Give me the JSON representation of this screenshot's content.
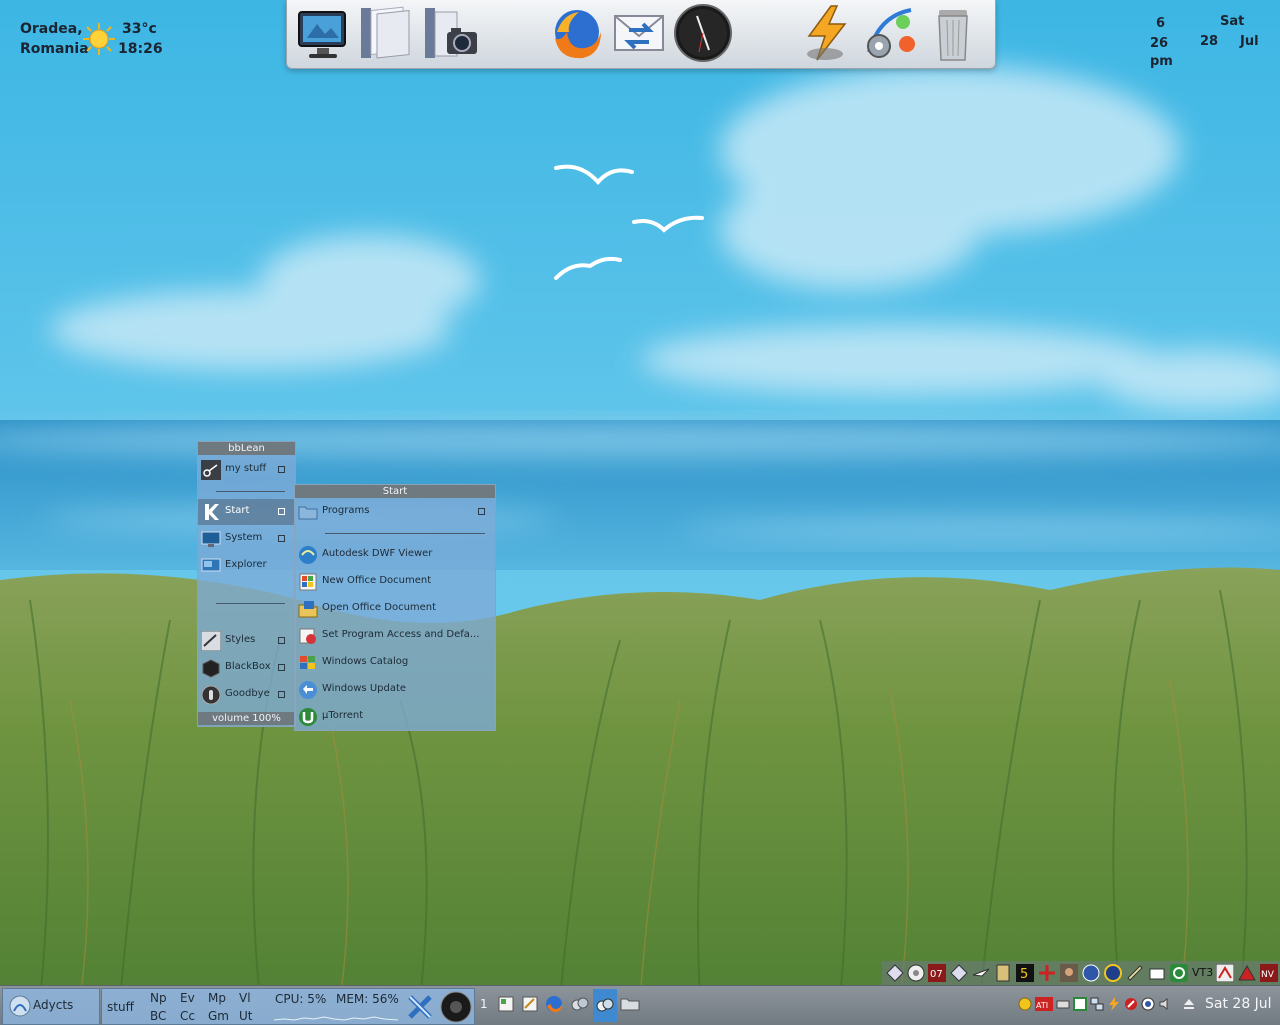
{
  "weather": {
    "city": "Oradea,",
    "country": "Romania",
    "temperature": "33°c",
    "time": "18:26",
    "condition_icon": "sun-icon"
  },
  "dock": {
    "items": [
      {
        "name": "desktop-monitor-icon"
      },
      {
        "name": "documents-icon"
      },
      {
        "name": "pictures-camera-icon"
      },
      {
        "name": "firefox-icon"
      },
      {
        "name": "mail-sync-icon"
      },
      {
        "name": "clock-icon"
      },
      {
        "name": "winamp-icon"
      },
      {
        "name": "settings-icon"
      },
      {
        "name": "trash-icon"
      }
    ]
  },
  "date_widget": {
    "hour": "6",
    "minute": "26",
    "ampm": "pm",
    "weekday": "Sat",
    "day": "28",
    "month": "Jul"
  },
  "bblean_menu": {
    "title": "bbLean",
    "items": [
      {
        "label": "my stuff",
        "icon": "mystuff-icon",
        "submenu": true
      },
      {
        "label": "Start",
        "icon": "kde-start-icon",
        "submenu": true,
        "active": true
      },
      {
        "label": "System",
        "icon": "monitor-icon",
        "submenu": true
      },
      {
        "label": "Explorer",
        "icon": "explorer-icon",
        "submenu": false
      },
      {
        "label": "Styles",
        "icon": "styles-icon",
        "submenu": true
      },
      {
        "label": "BlackBox",
        "icon": "blackbox-icon",
        "submenu": true
      },
      {
        "label": "Goodbye",
        "icon": "goodbye-icon",
        "submenu": true
      }
    ],
    "footer": "volume 100%"
  },
  "start_menu": {
    "title": "Start",
    "items": [
      {
        "label": "Programs",
        "icon": "folder-icon",
        "submenu": true
      },
      {
        "label": "Autodesk DWF Viewer",
        "icon": "autodesk-icon"
      },
      {
        "label": "New Office Document",
        "icon": "office-new-icon"
      },
      {
        "label": "Open Office Document",
        "icon": "office-open-icon"
      },
      {
        "label": "Set Program Access and Defa...",
        "icon": "program-access-icon"
      },
      {
        "label": "Windows Catalog",
        "icon": "windows-catalog-icon"
      },
      {
        "label": "Windows Update",
        "icon": "windows-update-icon"
      },
      {
        "label": "µTorrent",
        "icon": "utorrent-icon"
      }
    ]
  },
  "taskbar": {
    "user": "Adycts",
    "workspace_label": "stuff",
    "shortcuts_top": [
      "Np",
      "Ev",
      "Mp",
      "Vl"
    ],
    "shortcuts_bottom": [
      "BC",
      "Cc",
      "Gm",
      "Ut"
    ],
    "cpu": "CPU: 5%",
    "mem": "MEM: 56%",
    "desktop_number": "1",
    "clock": "Sat 28 Jul"
  },
  "tray_upper_text": "VT3"
}
